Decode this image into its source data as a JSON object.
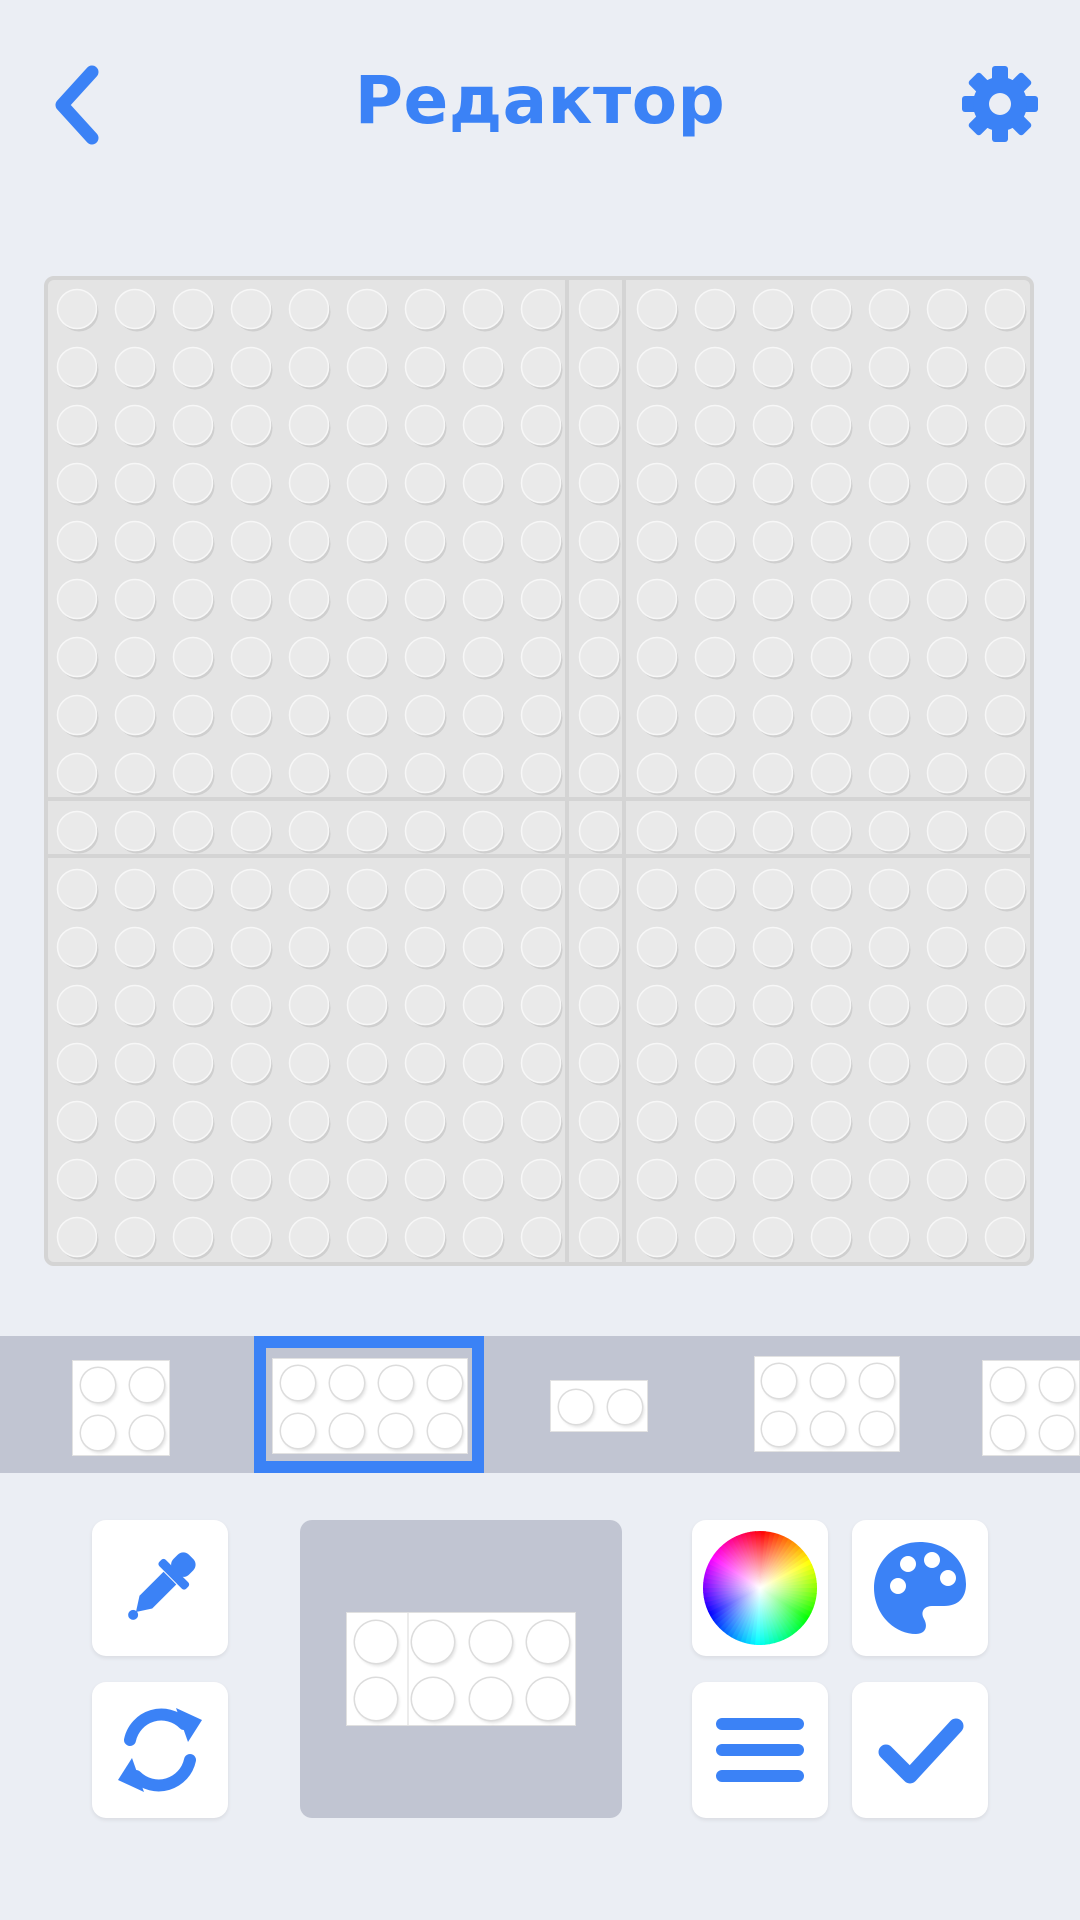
{
  "header": {
    "title": "Редактор",
    "back_icon": "chevron-left-icon",
    "settings_icon": "gear-icon"
  },
  "colors": {
    "accent": "#3b82f6",
    "background": "#ebeef4",
    "board": "#e4e4e4",
    "stud": "#eaeaea",
    "strip": "#c1c5d2"
  },
  "board": {
    "studs_per_row": 17,
    "rows": 17,
    "seam_after_columns": [
      8,
      9
    ],
    "seam_after_rows": [
      8,
      9
    ]
  },
  "brick_strip": {
    "items": [
      {
        "cols": 2,
        "rows": 2,
        "selected": false
      },
      {
        "cols": 4,
        "rows": 2,
        "selected": true
      },
      {
        "cols": 2,
        "rows": 1,
        "selected": false
      },
      {
        "cols": 3,
        "rows": 2,
        "selected": false
      },
      {
        "cols": 2,
        "rows": 2,
        "selected": false
      }
    ]
  },
  "tools": {
    "eyedropper": "eyedropper-icon",
    "rotate": "rotate-icon",
    "color_wheel": "color-wheel-icon",
    "palette": "palette-icon",
    "menu": "menu-icon",
    "confirm": "checkmark-icon"
  },
  "preview": {
    "cols": 4,
    "rows": 2
  }
}
